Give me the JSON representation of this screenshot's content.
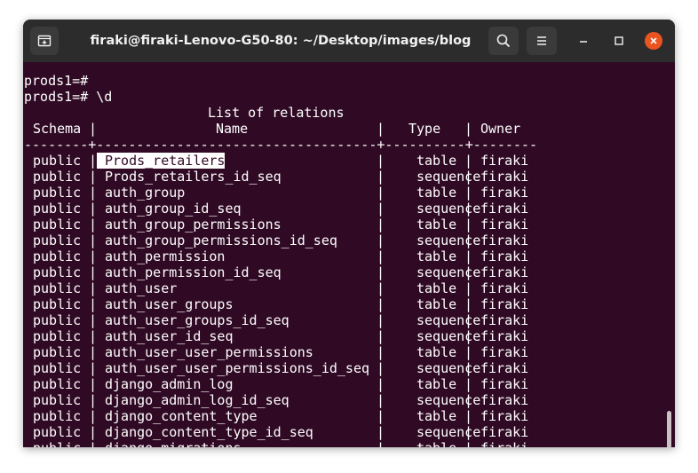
{
  "window": {
    "title": "firaki@firaki-Lenovo-G50-80: ~/Desktop/images/blog",
    "icons": {
      "new_tab": "new-tab-icon",
      "search": "search-icon",
      "menu": "hamburger-menu-icon",
      "minimize": "minimize-icon",
      "maximize": "maximize-icon",
      "close": "close-icon"
    },
    "colors": {
      "terminal_bg": "#300a24",
      "titlebar_bg": "#2c2c2c",
      "close_button": "#e95420",
      "text": "#ffffff"
    }
  },
  "terminal": {
    "partial_top": "^",
    "lines": [
      "prods1=#",
      "prods1=# \\d"
    ],
    "table": {
      "caption": "List of relations",
      "headers": [
        "Schema",
        "Name",
        "Type",
        "Owner"
      ],
      "separator": "--------+-----------------------------------+----------+--------",
      "selected_row": 0,
      "rows": [
        [
          "public",
          "Prods_retailers",
          "table",
          "firaki"
        ],
        [
          "public",
          "Prods_retailers_id_seq",
          "sequence",
          "firaki"
        ],
        [
          "public",
          "auth_group",
          "table",
          "firaki"
        ],
        [
          "public",
          "auth_group_id_seq",
          "sequence",
          "firaki"
        ],
        [
          "public",
          "auth_group_permissions",
          "table",
          "firaki"
        ],
        [
          "public",
          "auth_group_permissions_id_seq",
          "sequence",
          "firaki"
        ],
        [
          "public",
          "auth_permission",
          "table",
          "firaki"
        ],
        [
          "public",
          "auth_permission_id_seq",
          "sequence",
          "firaki"
        ],
        [
          "public",
          "auth_user",
          "table",
          "firaki"
        ],
        [
          "public",
          "auth_user_groups",
          "table",
          "firaki"
        ],
        [
          "public",
          "auth_user_groups_id_seq",
          "sequence",
          "firaki"
        ],
        [
          "public",
          "auth_user_id_seq",
          "sequence",
          "firaki"
        ],
        [
          "public",
          "auth_user_user_permissions",
          "table",
          "firaki"
        ],
        [
          "public",
          "auth_user_user_permissions_id_seq",
          "sequence",
          "firaki"
        ],
        [
          "public",
          "django_admin_log",
          "table",
          "firaki"
        ],
        [
          "public",
          "django_admin_log_id_seq",
          "sequence",
          "firaki"
        ],
        [
          "public",
          "django_content_type",
          "table",
          "firaki"
        ],
        [
          "public",
          "django_content_type_id_seq",
          "sequence",
          "firaki"
        ],
        [
          "public",
          "django_migrations",
          "table",
          "firaki"
        ]
      ]
    }
  }
}
